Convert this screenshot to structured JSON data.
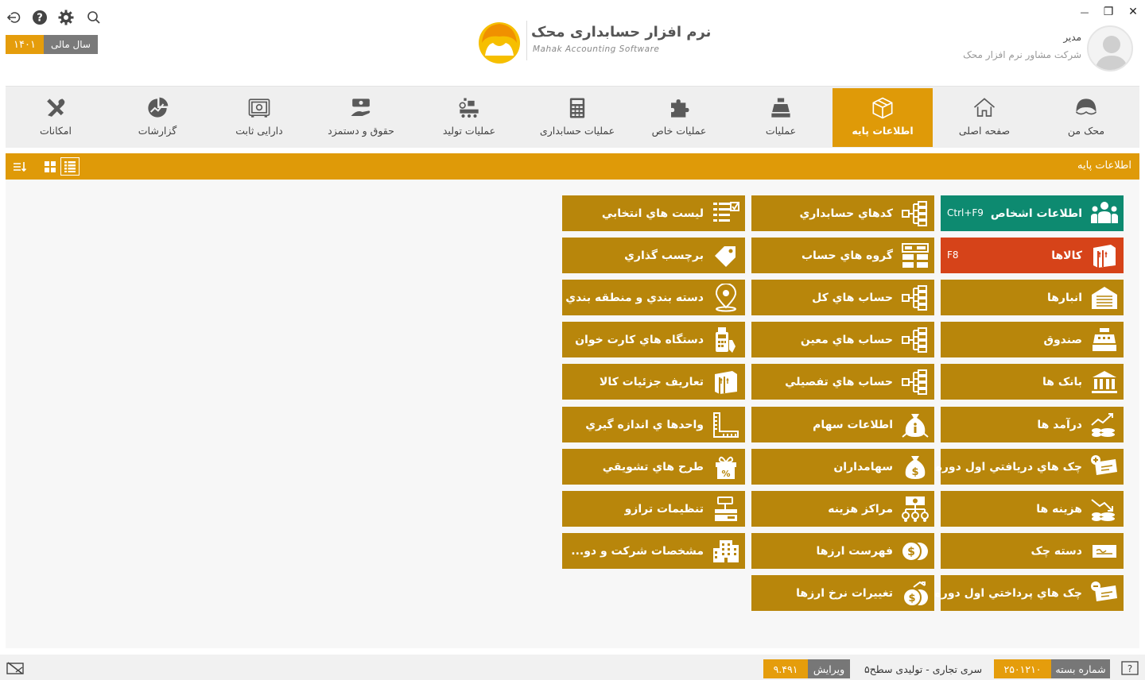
{
  "window": {
    "close": "✕",
    "restore": "❐",
    "minimize": "—"
  },
  "fiscal_year": {
    "label": "سال مالی",
    "value": "۱۴۰۱"
  },
  "user": {
    "role": "مدیر",
    "company": "شرکت مشاور نرم افزار محک"
  },
  "logo": {
    "fa": "نرم افزار حسابداری محک",
    "en": "Mahak Accounting Software"
  },
  "nav": [
    {
      "label": "محک من",
      "icon": "mahak-icon"
    },
    {
      "label": "صفحه اصلی",
      "icon": "home-icon"
    },
    {
      "label": "اطلاعات پایه",
      "icon": "box-icon",
      "active": true
    },
    {
      "label": "عملیات",
      "icon": "cash-register-icon"
    },
    {
      "label": "عملیات خاص",
      "icon": "puzzle-icon"
    },
    {
      "label": "عملیات حسابداری",
      "icon": "calculator-icon"
    },
    {
      "label": "عملیات تولید",
      "icon": "factory-icon"
    },
    {
      "label": "حقوق و دستمزد",
      "icon": "salary-icon"
    },
    {
      "label": "دارایی ثابت",
      "icon": "safe-icon"
    },
    {
      "label": "گزارشات",
      "icon": "chart-icon"
    },
    {
      "label": "امکانات",
      "icon": "tools-icon"
    }
  ],
  "subbar": {
    "title": "اطلاعات پایه"
  },
  "tiles": {
    "col1": [
      {
        "label": "اطلاعات اشخاص",
        "hotkey": "Ctrl+F9",
        "icon": "people-icon",
        "style": "green"
      },
      {
        "label": "کالاها",
        "hotkey": "F8",
        "icon": "goods-icon",
        "style": "red"
      },
      {
        "label": "انبارها",
        "icon": "warehouse-icon"
      },
      {
        "label": "صندوق",
        "icon": "cashbox-icon"
      },
      {
        "label": "بانک ها",
        "icon": "bank-icon"
      },
      {
        "label": "درآمد ها",
        "icon": "income-icon"
      },
      {
        "label": "چک هاي دريافتي اول دوره",
        "icon": "received-check-icon"
      },
      {
        "label": "هزينه ها",
        "icon": "expense-icon"
      },
      {
        "label": "دسته چک",
        "icon": "checkbook-icon"
      },
      {
        "label": "چک هاي پرداختي اول دوره",
        "icon": "paid-check-icon"
      }
    ],
    "col2": [
      {
        "label": "کدهاي حسابداري",
        "icon": "tree-icon"
      },
      {
        "label": "گروه هاي حساب",
        "icon": "account-group-icon"
      },
      {
        "label": "حساب هاي کل",
        "icon": "tree-icon"
      },
      {
        "label": "حساب هاي معين",
        "icon": "tree-icon"
      },
      {
        "label": "حساب هاي تفصيلي",
        "icon": "tree-icon"
      },
      {
        "label": "اطلاعات سهام",
        "icon": "share-info-icon"
      },
      {
        "label": "سهامداران",
        "icon": "shareholder-icon"
      },
      {
        "label": "مراکز هزينه",
        "icon": "cost-center-icon"
      },
      {
        "label": "فهرست ارزها",
        "icon": "currency-icon"
      },
      {
        "label": "تغييرات نرخ ارزها",
        "icon": "currency-rate-icon"
      }
    ],
    "col3": [
      {
        "label": "ليست هاي انتخابي",
        "icon": "checklist-icon"
      },
      {
        "label": "برچسب گذاري",
        "icon": "tag-icon"
      },
      {
        "label": "دسته بندي و منطقه بندي",
        "icon": "location-icon"
      },
      {
        "label": "دستگاه هاي کارت خوان",
        "icon": "pos-icon"
      },
      {
        "label": "تعاريف جزئيات کالا",
        "icon": "goods-detail-icon"
      },
      {
        "label": "واحدها ي اندازه گيري",
        "icon": "ruler-icon"
      },
      {
        "label": "طرح هاي تشويقي",
        "icon": "gift-icon"
      },
      {
        "label": "تنظيمات ترازو",
        "icon": "scale-icon"
      },
      {
        "label": "مشخصات شرکت و دو...",
        "icon": "company-icon"
      }
    ]
  },
  "status": {
    "package_label": "شماره بسته",
    "package_value": "۲۵۰۱۲۱۰",
    "edition": "سری تجاری - تولیدی سطح۵",
    "version_label": "ویرایش",
    "version_value": "۹.۴۹۱"
  },
  "colors": {
    "accent": "#df9a08",
    "tile": "#b8860b",
    "people": "#0d8a70",
    "goods": "#d64319"
  }
}
